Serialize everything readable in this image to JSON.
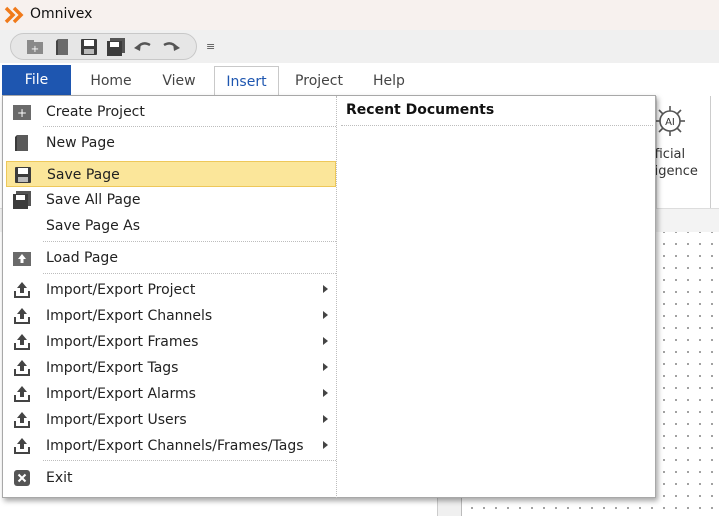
{
  "app": {
    "title": "Omnivex"
  },
  "colors": {
    "accent": "#1e56b0",
    "highlight": "#fbe69a",
    "logo": "#f07a1a"
  },
  "quick_access": [
    "new-project-icon",
    "new-page-icon",
    "save-icon",
    "save-all-icon",
    "undo-icon",
    "redo-icon",
    "customize-icon"
  ],
  "tabs": {
    "file": "File",
    "home": "Home",
    "view": "View",
    "insert": "Insert",
    "project": "Project",
    "help": "Help"
  },
  "ribbon": {
    "ai_label": "ificial\nligence",
    "ai_icon_text": "AI"
  },
  "menu": {
    "items": [
      {
        "label": "Create Project",
        "icon": "create-project-icon"
      },
      {
        "label": "New Page",
        "icon": "new-page-icon"
      },
      {
        "label": "Save Page",
        "icon": "save-icon",
        "highlighted": true
      },
      {
        "label": "Save All Page",
        "icon": "save-all-icon"
      },
      {
        "label": "Save Page As",
        "icon": "none"
      },
      {
        "label": "Load Page",
        "icon": "load-page-icon"
      },
      {
        "label": "Import/Export Project",
        "icon": "upload-icon",
        "submenu": true
      },
      {
        "label": "Import/Export Channels",
        "icon": "upload-icon",
        "submenu": true
      },
      {
        "label": "Import/Export Frames",
        "icon": "upload-icon",
        "submenu": true
      },
      {
        "label": "Import/Export Tags",
        "icon": "upload-icon",
        "submenu": true
      },
      {
        "label": "Import/Export Alarms",
        "icon": "upload-icon",
        "submenu": true
      },
      {
        "label": "Import/Export Users",
        "icon": "upload-icon",
        "submenu": true
      },
      {
        "label": "Import/Export Channels/Frames/Tags",
        "icon": "upload-icon",
        "submenu": true
      },
      {
        "label": "Exit",
        "icon": "exit-icon"
      }
    ],
    "recent_title": "Recent Documents"
  }
}
